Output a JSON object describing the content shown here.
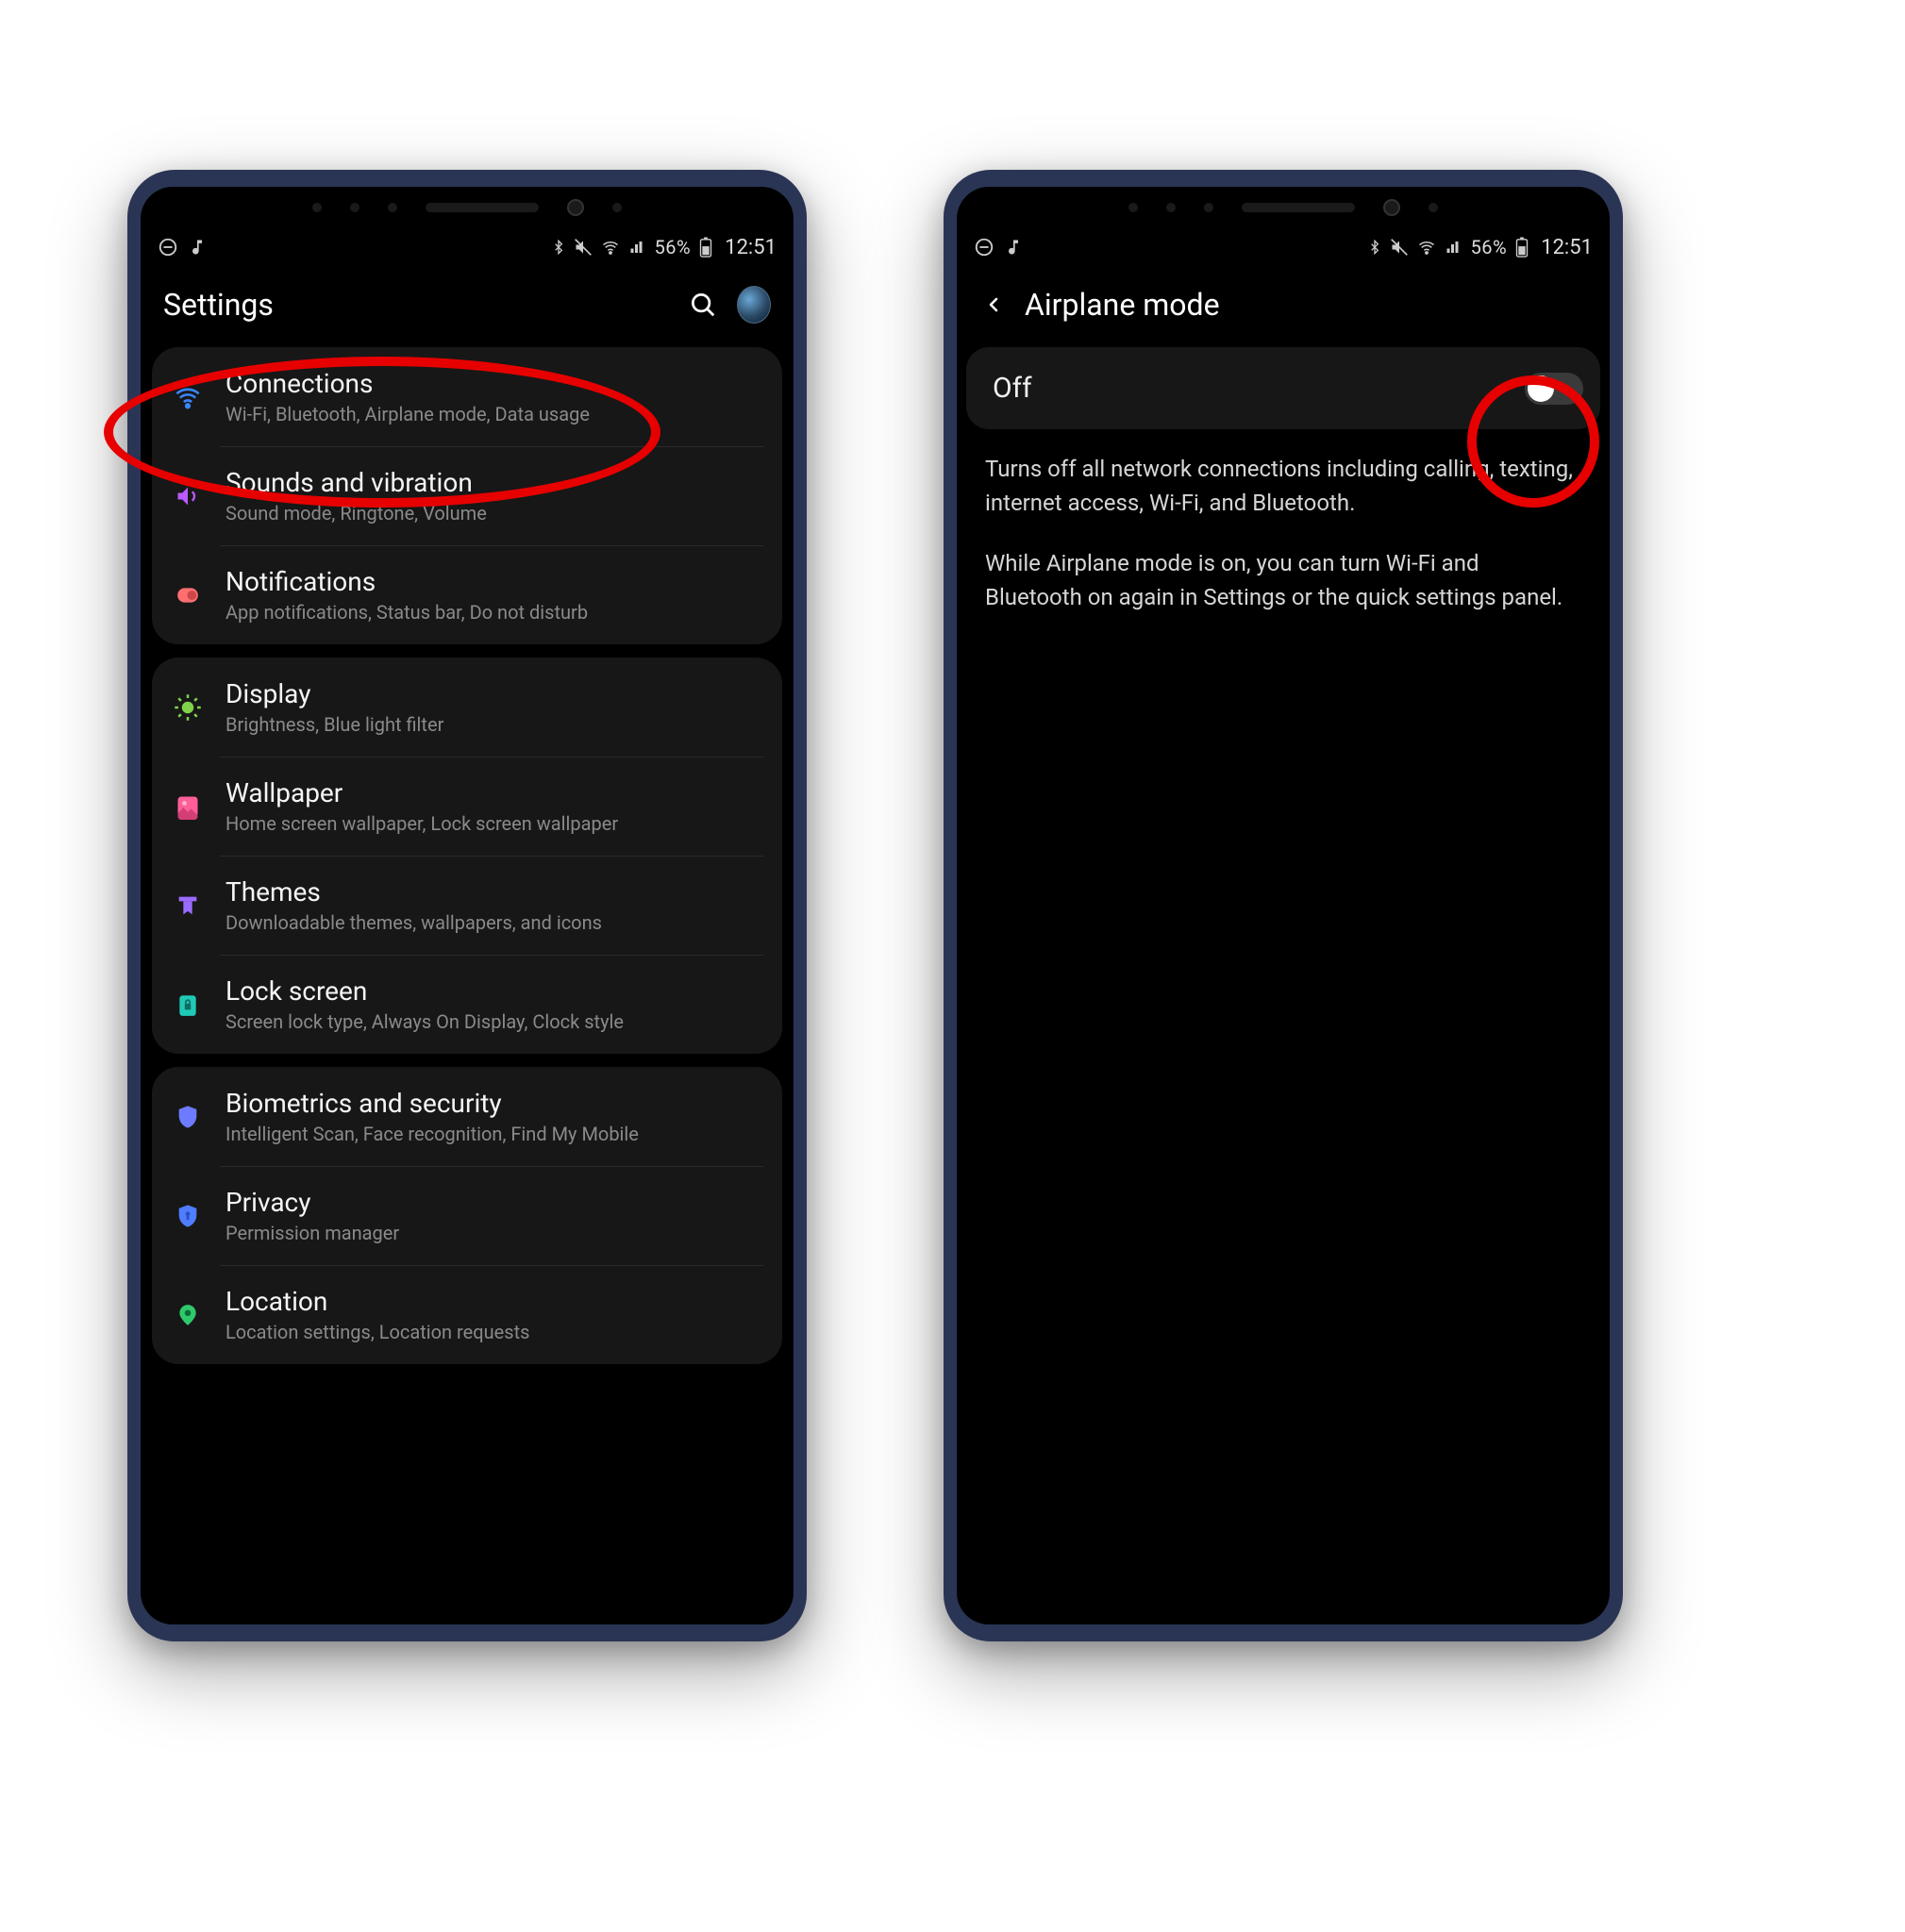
{
  "status": {
    "battery_text": "56%",
    "time": "12:51"
  },
  "left_phone": {
    "header": {
      "title": "Settings"
    },
    "groups": [
      {
        "rows": [
          {
            "icon": "wifi",
            "icon_color": "#3a86ff",
            "title": "Connections",
            "sub": "Wi-Fi, Bluetooth, Airplane mode, Data usage"
          },
          {
            "icon": "sound",
            "icon_color": "#b95bff",
            "title": "Sounds and vibration",
            "sub": "Sound mode, Ringtone, Volume"
          },
          {
            "icon": "notif",
            "icon_color": "#ff6f6f",
            "title": "Notifications",
            "sub": "App notifications, Status bar, Do not disturb"
          }
        ]
      },
      {
        "rows": [
          {
            "icon": "display",
            "icon_color": "#7fd24a",
            "title": "Display",
            "sub": "Brightness, Blue light filter"
          },
          {
            "icon": "wallpaper",
            "icon_color": "#ff5f98",
            "title": "Wallpaper",
            "sub": "Home screen wallpaper, Lock screen wallpaper"
          },
          {
            "icon": "themes",
            "icon_color": "#9a6bff",
            "title": "Themes",
            "sub": "Downloadable themes, wallpapers, and icons"
          },
          {
            "icon": "lock",
            "icon_color": "#1fc9b5",
            "title": "Lock screen",
            "sub": "Screen lock type, Always On Display, Clock style"
          }
        ]
      },
      {
        "rows": [
          {
            "icon": "shield",
            "icon_color": "#6d7bff",
            "title": "Biometrics and security",
            "sub": "Intelligent Scan, Face recognition, Find My Mobile"
          },
          {
            "icon": "privacy",
            "icon_color": "#4f7dff",
            "title": "Privacy",
            "sub": "Permission manager"
          },
          {
            "icon": "location",
            "icon_color": "#2fc96c",
            "title": "Location",
            "sub": "Location settings, Location requests"
          }
        ]
      }
    ]
  },
  "right_phone": {
    "header": {
      "title": "Airplane mode"
    },
    "toggle": {
      "label": "Off",
      "state": "off"
    },
    "description": {
      "p1": "Turns off all network connections including calling, texting, internet access, Wi-Fi, and Bluetooth.",
      "p2": "While Airplane mode is on, you can turn Wi-Fi and Bluetooth on again in Settings or the quick settings panel."
    }
  }
}
